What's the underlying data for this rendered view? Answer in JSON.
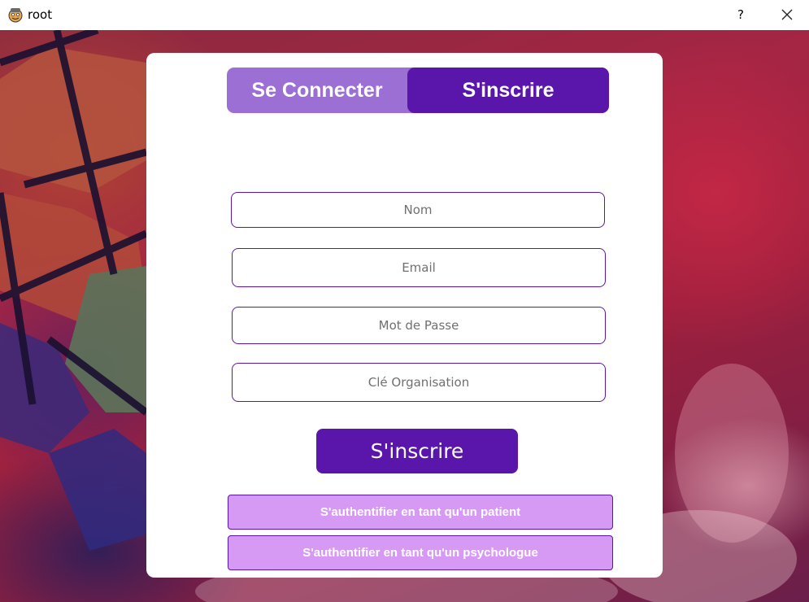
{
  "window": {
    "title": "root",
    "help_label": "?",
    "app_icon": "cartoon-face-icon",
    "close_icon": "close-icon"
  },
  "tabs": {
    "login_label": "Se Connecter",
    "signup_label": "S'inscrire",
    "active": "S'inscrire"
  },
  "form": {
    "nom_placeholder": "Nom",
    "email_placeholder": "Email",
    "password_placeholder": "Mot de Passe",
    "org_key_placeholder": "Clé Organisation",
    "submit_label": "S'inscrire"
  },
  "auth": {
    "patient_label": "S'authentifier en tant qu'un patient",
    "psychologist_label": "S'authentifier en tant qu'un psychologue"
  },
  "colors": {
    "accent": "#5a16aa",
    "tab_inactive": "#9b6fd3",
    "auth_button": "#d69af5"
  }
}
